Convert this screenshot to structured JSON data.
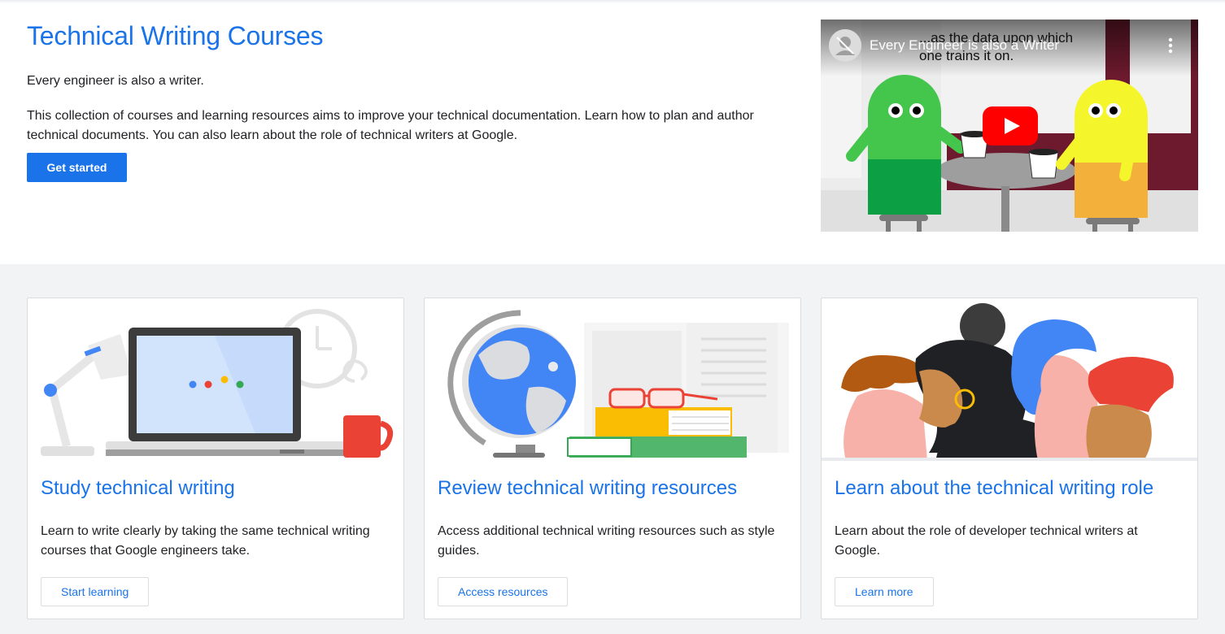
{
  "hero": {
    "title": "Technical Writing Courses",
    "tagline": "Every engineer is also a writer.",
    "description": "This collection of courses and learning resources aims to improve your technical documentation. Learn how to plan and author technical documents. You can also learn about the role of technical writers at Google.",
    "cta_label": "Get started"
  },
  "video": {
    "title": "Every Engineer is also a Writer",
    "caption_line1": "...as the data upon which",
    "caption_line2": "one trains it on."
  },
  "cards": [
    {
      "title": "Study technical writing",
      "description": "Learn to write clearly by taking the same technical writing courses that Google engineers take.",
      "button_label": "Start learning"
    },
    {
      "title": "Review technical writing resources",
      "description": "Access additional technical writing resources such as style guides.",
      "button_label": "Access resources"
    },
    {
      "title": "Learn about the technical writing role",
      "description": "Learn about the role of developer technical writers at Google.",
      "button_label": "Learn more"
    }
  ],
  "colors": {
    "brand_blue": "#1a73e8",
    "google_red": "#ea4335",
    "google_yellow": "#fbbc04",
    "google_green": "#34a853",
    "section_gray": "#f1f3f4"
  },
  "icons": [
    "play-icon",
    "more-vert-icon",
    "channel-avatar-icon"
  ]
}
